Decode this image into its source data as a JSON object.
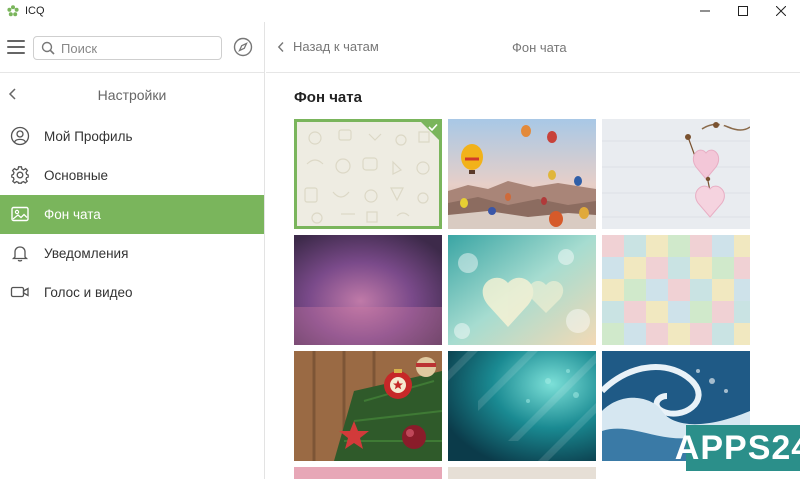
{
  "window": {
    "title": "ICQ",
    "controls": [
      "minimize",
      "maximize",
      "close"
    ]
  },
  "sidebar": {
    "search": {
      "placeholder": "Поиск",
      "value": ""
    },
    "settings_title": "Настройки",
    "items": [
      {
        "label": "Мой Профиль",
        "icon": "profile-icon",
        "active": false
      },
      {
        "label": "Основные",
        "icon": "gear-icon",
        "active": false
      },
      {
        "label": "Фон чата",
        "icon": "image-icon",
        "active": true
      },
      {
        "label": "Уведомления",
        "icon": "bell-icon",
        "active": false
      },
      {
        "label": "Голос и видео",
        "icon": "video-camera-icon",
        "active": false
      }
    ]
  },
  "main": {
    "back_label": "Назад к чатам",
    "header_title": "Фон чата",
    "section_title": "Фон чата",
    "wallpapers": [
      {
        "name": "doodle-pattern",
        "selected": true
      },
      {
        "name": "hot-air-balloons",
        "selected": false
      },
      {
        "name": "pink-hearts",
        "selected": false
      },
      {
        "name": "purple-gradient",
        "selected": false
      },
      {
        "name": "bokeh-hearts",
        "selected": false
      },
      {
        "name": "pastel-watercolor",
        "selected": false
      },
      {
        "name": "christmas-ornaments",
        "selected": false
      },
      {
        "name": "teal-mosaic",
        "selected": false
      },
      {
        "name": "ocean-wave",
        "selected": false
      }
    ]
  },
  "watermark": {
    "text": "APPS24"
  },
  "colors": {
    "accent": "#7ab55c",
    "watermark_bg": "#2b8f8a"
  }
}
